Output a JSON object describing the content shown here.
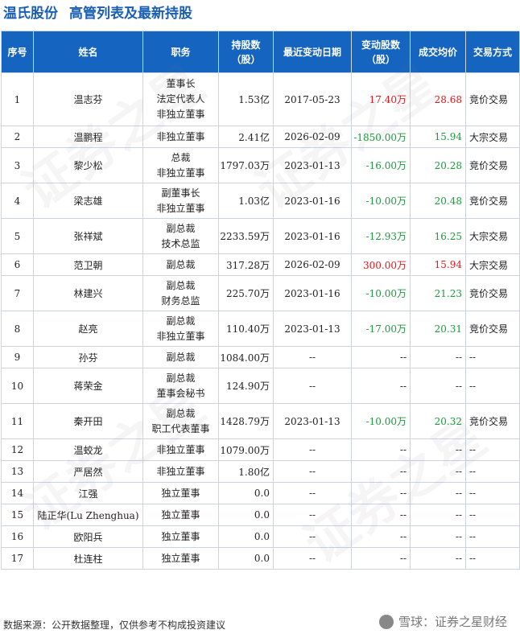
{
  "title": {
    "company": "温氏股份",
    "subtitle": "高管列表及最新持股"
  },
  "columns": [
    "序号",
    "姓名",
    "职务",
    "持股数\n（股）",
    "最近变动日期",
    "变动股数\n（股）",
    "成交均价",
    "交易方式"
  ],
  "rows": [
    {
      "no": "1",
      "name": "温志芬",
      "roles": [
        "董事长",
        "法定代表人",
        "非独立董事"
      ],
      "shares": "1.53亿",
      "date": "2017-05-23",
      "change": "17.40万",
      "price": "28.68",
      "method": "竞价交易"
    },
    {
      "no": "2",
      "name": "温鹏程",
      "roles": [
        "非独立董事"
      ],
      "shares": "2.41亿",
      "date": "2026-02-09",
      "change": "-1850.00万",
      "price": "15.94",
      "method": "大宗交易"
    },
    {
      "no": "3",
      "name": "黎少松",
      "roles": [
        "总裁",
        "非独立董事"
      ],
      "shares": "1797.03万",
      "date": "2023-01-13",
      "change": "-16.00万",
      "price": "20.28",
      "method": "竞价交易"
    },
    {
      "no": "4",
      "name": "梁志雄",
      "roles": [
        "副董事长",
        "非独立董事"
      ],
      "shares": "1.03亿",
      "date": "2023-01-16",
      "change": "-10.00万",
      "price": "20.48",
      "method": "竞价交易"
    },
    {
      "no": "5",
      "name": "张祥斌",
      "roles": [
        "副总裁",
        "技术总监"
      ],
      "shares": "2233.59万",
      "date": "2023-01-16",
      "change": "-12.93万",
      "price": "16.25",
      "method": "大宗交易"
    },
    {
      "no": "6",
      "name": "范卫朝",
      "roles": [
        "副总裁"
      ],
      "shares": "317.28万",
      "date": "2026-02-09",
      "change": "300.00万",
      "price": "15.94",
      "method": "大宗交易"
    },
    {
      "no": "7",
      "name": "林建兴",
      "roles": [
        "副总裁",
        "财务总监"
      ],
      "shares": "225.70万",
      "date": "2023-01-16",
      "change": "-10.00万",
      "price": "21.23",
      "method": "竞价交易"
    },
    {
      "no": "8",
      "name": "赵亮",
      "roles": [
        "副总裁",
        "非独立董事"
      ],
      "shares": "110.40万",
      "date": "2023-01-13",
      "change": "-17.00万",
      "price": "20.31",
      "method": "竞价交易"
    },
    {
      "no": "9",
      "name": "孙芬",
      "roles": [
        "副总裁"
      ],
      "shares": "1084.00万",
      "date": "--",
      "change": "--",
      "price": "--",
      "method": "--"
    },
    {
      "no": "10",
      "name": "蒋荣金",
      "roles": [
        "副总裁",
        "董事会秘书"
      ],
      "shares": "124.90万",
      "date": "--",
      "change": "--",
      "price": "--",
      "method": "--"
    },
    {
      "no": "11",
      "name": "秦开田",
      "roles": [
        "副总裁",
        "职工代表董事"
      ],
      "shares": "1428.79万",
      "date": "2023-01-13",
      "change": "-10.00万",
      "price": "20.32",
      "method": "竞价交易"
    },
    {
      "no": "12",
      "name": "温蛟龙",
      "roles": [
        "非独立董事"
      ],
      "shares": "1079.00万",
      "date": "--",
      "change": "--",
      "price": "--",
      "method": "--"
    },
    {
      "no": "13",
      "name": "严居然",
      "roles": [
        "非独立董事"
      ],
      "shares": "1.80亿",
      "date": "--",
      "change": "--",
      "price": "--",
      "method": "--"
    },
    {
      "no": "14",
      "name": "江强",
      "roles": [
        "独立董事"
      ],
      "shares": "0.0",
      "date": "--",
      "change": "--",
      "price": "--",
      "method": "--"
    },
    {
      "no": "15",
      "name": "陆正华(Lu Zhenghua)",
      "roles": [
        "独立董事"
      ],
      "shares": "0.0",
      "date": "--",
      "change": "--",
      "price": "--",
      "method": "--"
    },
    {
      "no": "16",
      "name": "欧阳兵",
      "roles": [
        "独立董事"
      ],
      "shares": "0.0",
      "date": "--",
      "change": "--",
      "price": "--",
      "method": "--"
    },
    {
      "no": "17",
      "name": "杜连柱",
      "roles": [
        "独立董事"
      ],
      "shares": "0.0",
      "date": "--",
      "change": "--",
      "price": "--",
      "method": "--"
    }
  ],
  "footer": "数据来源：公开数据整理，仅供参考不构成投资建议",
  "brand": "雪球：证券之星财经",
  "watermark": "证券之星",
  "colors": {
    "header_bg": "#1565c0",
    "title": "#1a5fb4",
    "up": "#e0161b",
    "down": "#1c9a3d"
  }
}
